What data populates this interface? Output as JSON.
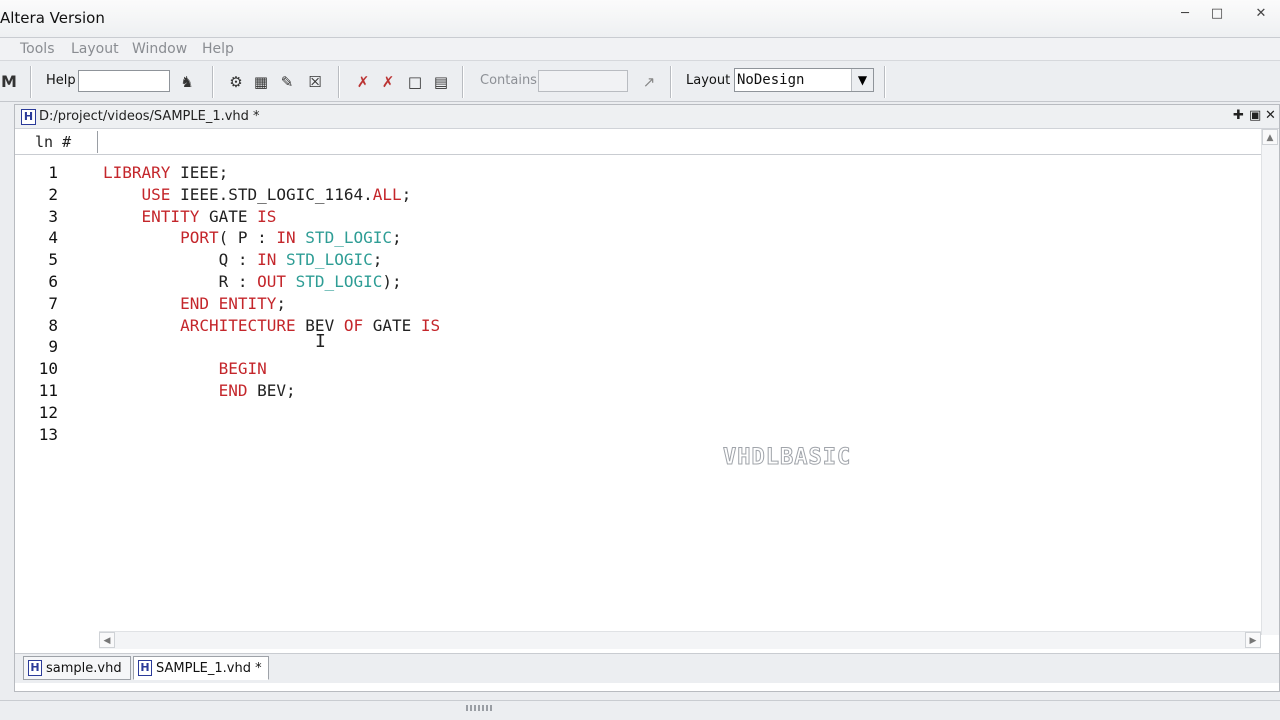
{
  "window": {
    "title": "Altera Version"
  },
  "menu": [
    "Tools",
    "Layout",
    "Window",
    "Help"
  ],
  "toolbar": {
    "help_label": "Help",
    "contains_label": "Contains",
    "layout_label": "Layout",
    "layout_value": "NoDesign"
  },
  "editor": {
    "path": "D:/project/videos/SAMPLE_1.vhd *",
    "ruler_label": "ln #",
    "lines": [
      {
        "num": "1",
        "code": [
          {
            "t": "LIBRARY ",
            "c": "kw"
          },
          {
            "t": "IEEE;",
            "c": ""
          }
        ]
      },
      {
        "num": "2",
        "code": [
          {
            "t": "    USE ",
            "c": "kw"
          },
          {
            "t": "IEEE.STD_LOGIC_1164.",
            "c": ""
          },
          {
            "t": "ALL",
            "c": "kw"
          },
          {
            "t": ";",
            "c": ""
          }
        ]
      },
      {
        "num": "3",
        "code": [
          {
            "t": "    ENTITY ",
            "c": "kw"
          },
          {
            "t": "GATE ",
            "c": ""
          },
          {
            "t": "IS",
            "c": "kw"
          }
        ]
      },
      {
        "num": "4",
        "code": [
          {
            "t": "        PORT",
            "c": "kw"
          },
          {
            "t": "( P : ",
            "c": ""
          },
          {
            "t": "IN ",
            "c": "kw"
          },
          {
            "t": "STD_LOGIC",
            "c": "ty"
          },
          {
            "t": ";",
            "c": ""
          }
        ]
      },
      {
        "num": "5",
        "code": [
          {
            "t": "            Q : ",
            "c": ""
          },
          {
            "t": "IN ",
            "c": "kw"
          },
          {
            "t": "STD_LOGIC",
            "c": "ty"
          },
          {
            "t": ";",
            "c": ""
          }
        ]
      },
      {
        "num": "6",
        "code": [
          {
            "t": "            R : ",
            "c": ""
          },
          {
            "t": "OUT ",
            "c": "kw"
          },
          {
            "t": "STD_LOGIC",
            "c": "ty"
          },
          {
            "t": ");",
            "c": ""
          }
        ]
      },
      {
        "num": "7",
        "code": [
          {
            "t": "        END ENTITY",
            "c": "kw"
          },
          {
            "t": ";",
            "c": ""
          }
        ]
      },
      {
        "num": "8",
        "code": [
          {
            "t": "        ARCHITECTURE ",
            "c": "kw"
          },
          {
            "t": "BEV ",
            "c": ""
          },
          {
            "t": "OF ",
            "c": "kw"
          },
          {
            "t": "GATE ",
            "c": ""
          },
          {
            "t": "IS",
            "c": "kw"
          }
        ]
      },
      {
        "num": "9",
        "code": []
      },
      {
        "num": "10",
        "code": [
          {
            "t": "            BEGIN",
            "c": "kw"
          }
        ]
      },
      {
        "num": "11",
        "code": [
          {
            "t": "            END ",
            "c": "kw"
          },
          {
            "t": "BEV;",
            "c": ""
          }
        ]
      },
      {
        "num": "12",
        "code": []
      },
      {
        "num": "13",
        "code": []
      }
    ]
  },
  "watermark": "VHDLBASIC",
  "tabs": [
    {
      "label": "sample.vhd",
      "active": false
    },
    {
      "label": "SAMPLE_1.vhd *",
      "active": true
    }
  ],
  "colors": {
    "keyword": "#c4262b",
    "type": "#2e9d95"
  }
}
